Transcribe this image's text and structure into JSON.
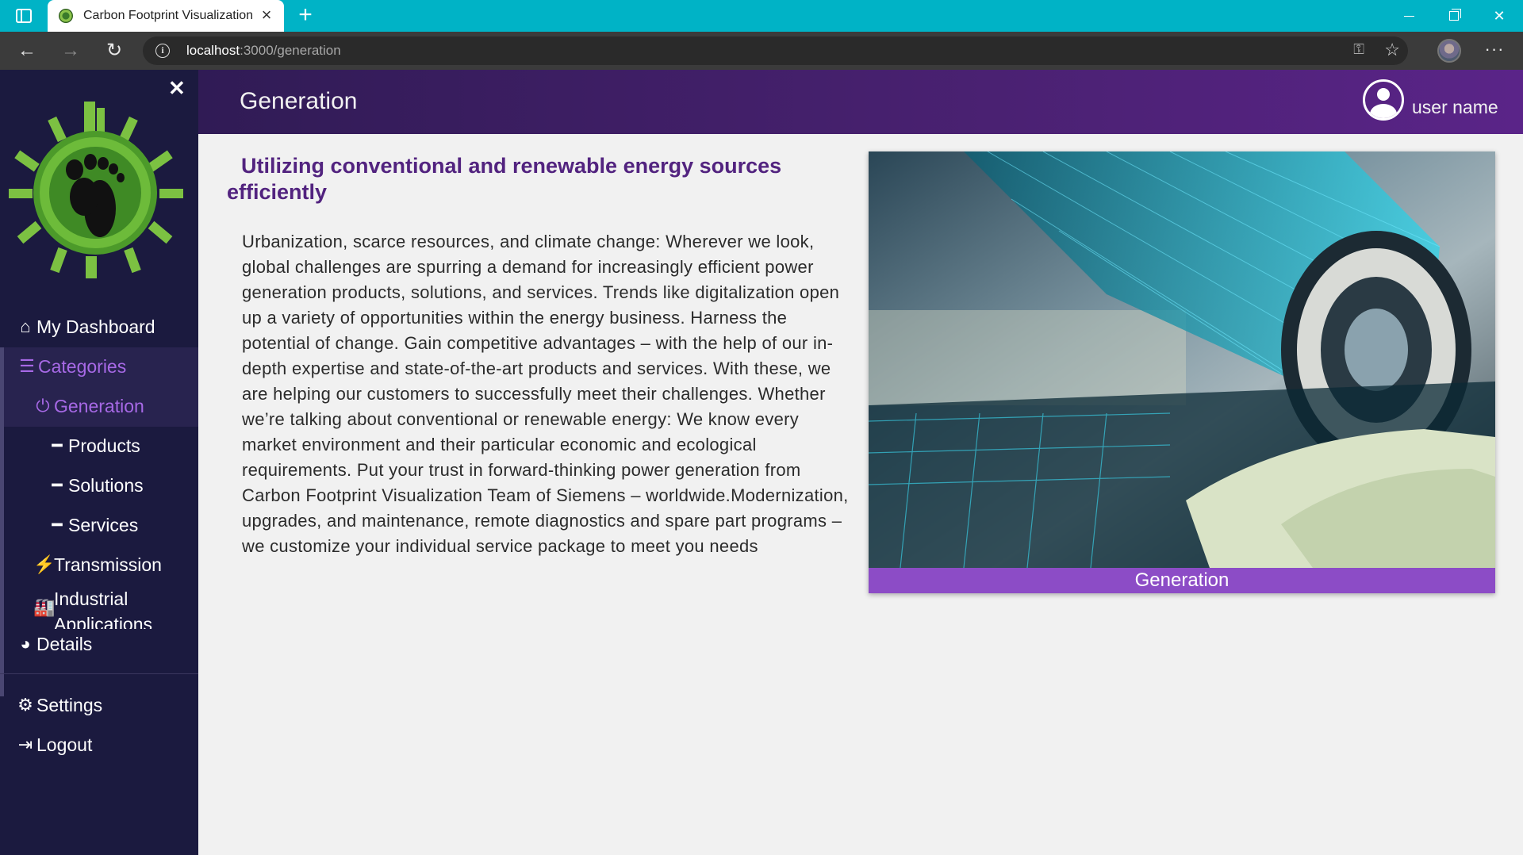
{
  "browser": {
    "tab_title": "Carbon Footprint Visualization",
    "url_host": "localhost",
    "url_path": ":3000/generation"
  },
  "sidebar": {
    "items": [
      {
        "label": "My Dashboard",
        "icon": "home-icon"
      },
      {
        "label": "Categories",
        "icon": "list-icon"
      },
      {
        "label": "Generation",
        "icon": "power-icon"
      },
      {
        "label": "Products",
        "icon": "dash-icon"
      },
      {
        "label": "Solutions",
        "icon": "dash-icon"
      },
      {
        "label": "Services",
        "icon": "dash-icon"
      },
      {
        "label": "Transmission",
        "icon": "plug-icon"
      },
      {
        "label": "Industrial Applications",
        "icon": "factory-icon"
      },
      {
        "label": "Details",
        "icon": "pie-chart-icon"
      },
      {
        "label": "Settings",
        "icon": "gears-icon"
      },
      {
        "label": "Logout",
        "icon": "logout-icon"
      }
    ],
    "active_color": "#a769e6"
  },
  "header": {
    "title": "Generation",
    "user_name": "user name"
  },
  "main": {
    "headline": "Utilizing conventional and renewable energy sources efficiently",
    "body": "Urbanization, scarce resources, and climate change: Wherever we look, global challenges are spurring a demand for increasingly efficient power generation products, solutions, and services. Trends like digitalization open up a variety of opportunities within the energy business. Harness the potential of change. Gain competitive advantages – with the help of our in-depth expertise and state-of-the-art products and services. With these, we are helping our customers to successfully meet their challenges. Whether we’re talking about conventional or renewable energy: We know every market environment and their particular economic and ecological requirements. Put your trust in forward-thinking power generation from Carbon Footprint Visualization Team of Siemens – worldwide.Modernization, upgrades, and maintenance, remote diagnostics and spare part programs – we customize your individual service package to meet you needs",
    "image_caption": "Generation"
  }
}
